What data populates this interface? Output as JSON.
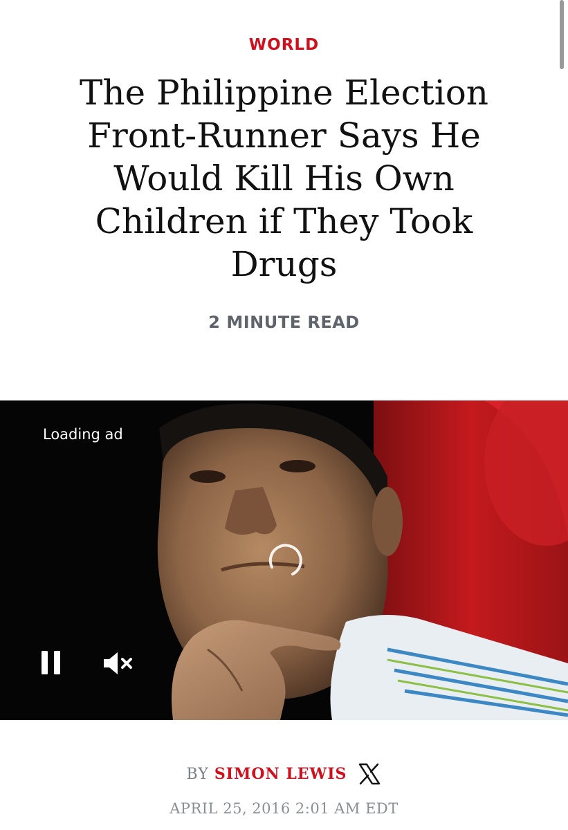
{
  "article": {
    "section": "WORLD",
    "headline": "The Philippine Election Front-Runner Says He Would Kill His Own Children if They Took Drugs",
    "read_time": "2 MINUTE READ",
    "byline_prefix": "BY",
    "author": "SIMON LEWIS",
    "date": "APRIL 25, 2016 2:01 AM EDT"
  },
  "video": {
    "loading_text": "Loading ad",
    "controls": {
      "pause_icon": "pause-icon",
      "mute_icon": "muted-speaker-icon"
    }
  },
  "icons": {
    "author_social": "x-logo-icon"
  },
  "colors": {
    "accent": "#d0101c",
    "headline": "#111111",
    "meta_gray": "#5f636b"
  }
}
